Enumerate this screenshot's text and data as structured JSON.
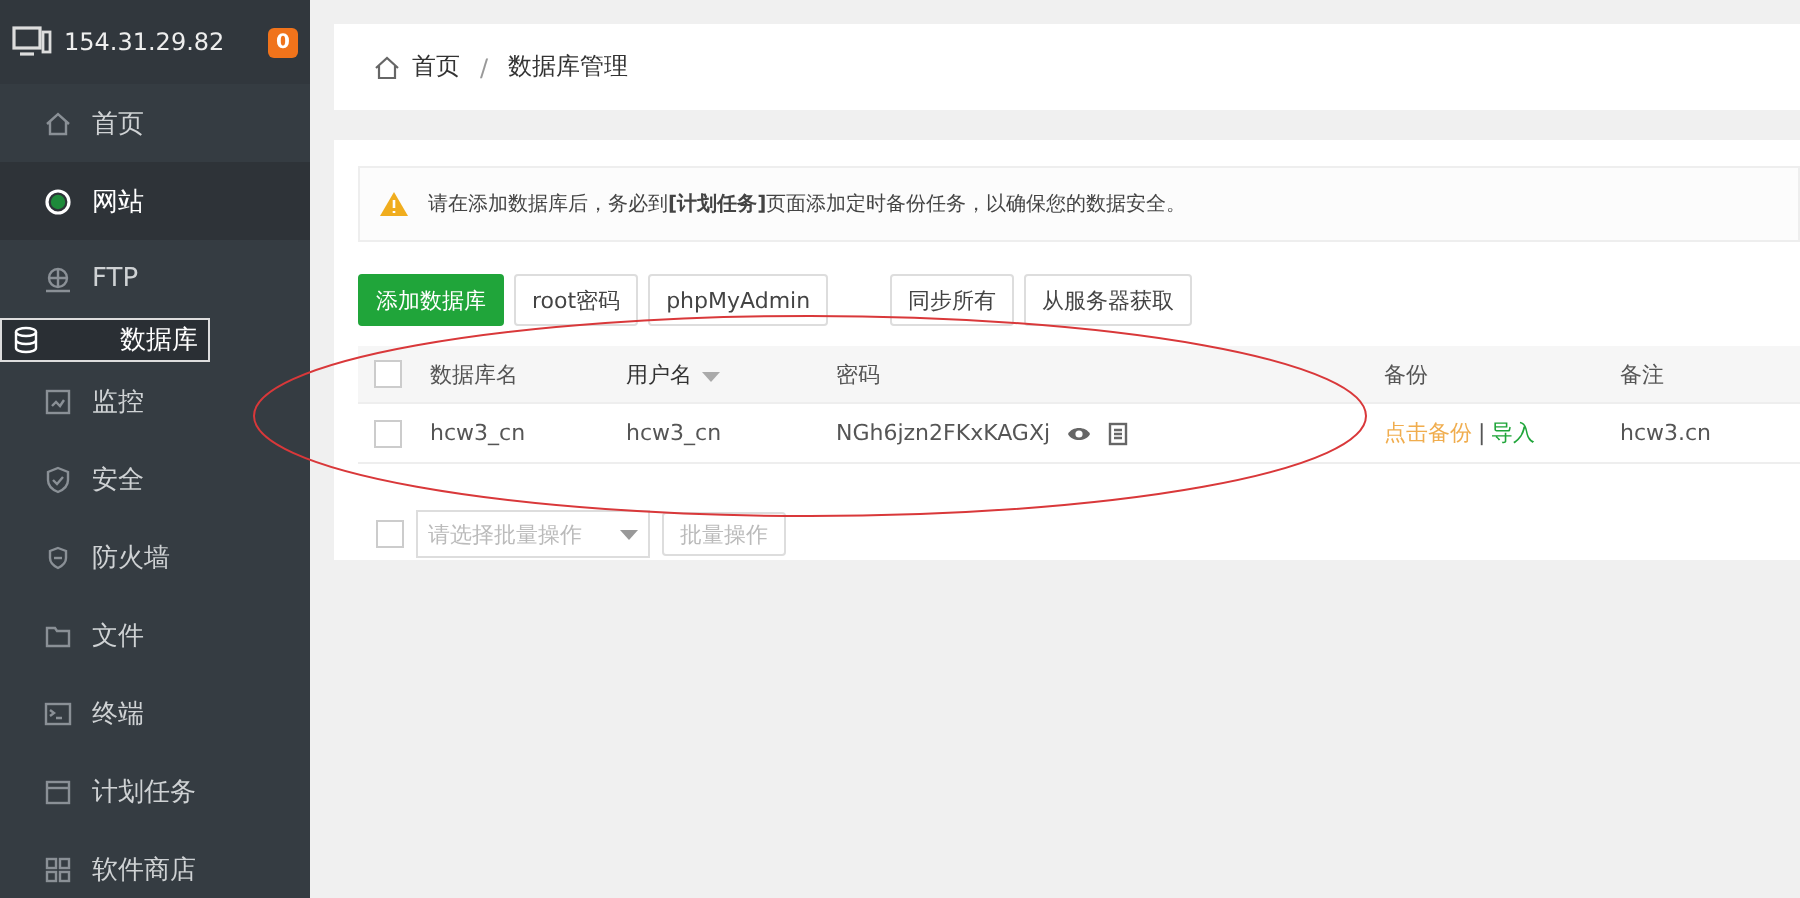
{
  "sidebar": {
    "server": "154.31.29.82",
    "badge": "0",
    "items": [
      {
        "label": "首页",
        "selected": false,
        "hovered": false
      },
      {
        "label": "网站",
        "selected": false,
        "hovered": true
      },
      {
        "label": "FTP",
        "selected": false,
        "hovered": false
      },
      {
        "label": "数据库",
        "selected": true,
        "hovered": false
      },
      {
        "label": "监控",
        "selected": false,
        "hovered": false
      },
      {
        "label": "安全",
        "selected": false,
        "hovered": false
      },
      {
        "label": "防火墙",
        "selected": false,
        "hovered": false
      },
      {
        "label": "文件",
        "selected": false,
        "hovered": false
      },
      {
        "label": "终端",
        "selected": false,
        "hovered": false
      },
      {
        "label": "计划任务",
        "selected": false,
        "hovered": false
      },
      {
        "label": "软件商店",
        "selected": false,
        "hovered": false
      }
    ]
  },
  "breadcrumb": {
    "home": "首页",
    "separator": "/",
    "current": "数据库管理"
  },
  "alert": "请在添加数据库后，务必到**[计划任务]**页面添加定时备份任务，以确保您的数据安全。",
  "toolbar": [
    {
      "label": "添加数据库",
      "kind": "primary"
    },
    {
      "label": "root密码",
      "kind": "default"
    },
    {
      "label": "phpMyAdmin",
      "kind": "default"
    },
    {
      "label": "同步所有",
      "kind": "default"
    },
    {
      "label": "从服务器获取",
      "kind": "default"
    }
  ],
  "table": {
    "all_checked": false,
    "columns": [
      {
        "label": "数据库名",
        "sortable": false
      },
      {
        "label": "用户名",
        "sortable": true
      },
      {
        "label": "密码",
        "sortable": false
      },
      {
        "label": "备份",
        "sortable": false
      },
      {
        "label": "备注",
        "sortable": false
      }
    ],
    "rows": [
      {
        "checked": false,
        "name": "hcw3_cn",
        "user": "hcw3_cn",
        "password": "NGh6jzn2FKxKAGXj",
        "backup": "点击备份",
        "separator": "|",
        "import": "导入",
        "note": "hcw3.cn"
      }
    ]
  },
  "batch": {
    "checked": false,
    "placeholder": "请选择批量操作",
    "button": "批量操作"
  }
}
